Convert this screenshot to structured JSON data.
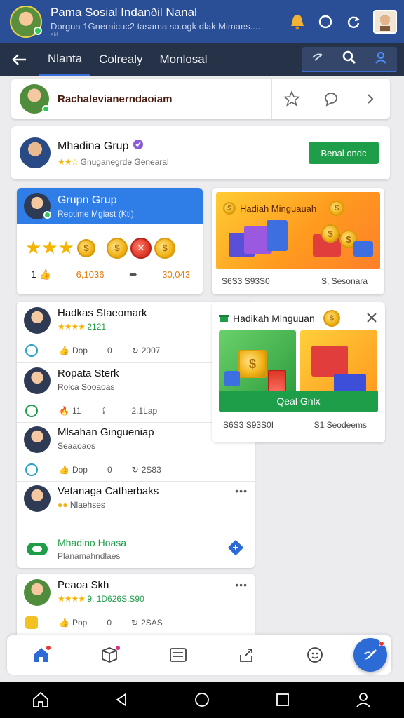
{
  "header": {
    "title": "Pama Sosial Indanðil Nanal",
    "subtitle": "Dorgua 1Gneraicuc2 tasama so.ogk dlak Mimaes....",
    "tiny": "aid"
  },
  "nav": {
    "tabs": [
      "Nlanta",
      "Colrealy",
      "Monlosal"
    ]
  },
  "profile_card": {
    "name": "Rachalevianerndaoiam"
  },
  "group_card": {
    "name": "Mhadina Grup",
    "meta": "Gnuganegrde Genearal",
    "button": "Benal ondc"
  },
  "group_panel": {
    "title": "Grupn Grup",
    "subtitle": "Reptime Mgiast (Kti)",
    "count": "1",
    "stat1": "6,1036",
    "stat2": "30,043"
  },
  "reward1": {
    "title": "Hadiah Minguauah",
    "foot_left": "S6S3 S93S0",
    "foot_right": "S, Sesonara"
  },
  "feed": [
    {
      "name": "Hadkas Sfaeomark",
      "sub": "2121",
      "a": "Dop",
      "b": "0",
      "c": "2007"
    },
    {
      "name": "Ropata Sterk",
      "sub": "Rolca Sooaoas",
      "a": "11",
      "b": "",
      "c": "2.1Lap"
    },
    {
      "name": "Mlsahan Gingueniap",
      "sub": "Seaaoaos",
      "a": "Dop",
      "b": "0",
      "c": "2S83"
    },
    {
      "name": "Vetanaga Catherbaks",
      "sub": "Nlaehses"
    }
  ],
  "feed_tail": {
    "name": "Mhadino Hoasa",
    "sub": "Planamahndlaes"
  },
  "reward2": {
    "title": "Hadikah Minguuan",
    "button": "Qeal Gnlx",
    "foot_left": "S6S3 S93S0I",
    "foot_right": "S1 Seodeems"
  },
  "feed2": {
    "name": "Peaoa Skh",
    "sub": "9. 1D626S.S90",
    "a": "Pop",
    "b": "0",
    "c": "2SAS"
  },
  "colors": {
    "header": "#2b4f96",
    "nav": "#263247",
    "accent": "#2f7de6",
    "green": "#1f9e4a"
  }
}
